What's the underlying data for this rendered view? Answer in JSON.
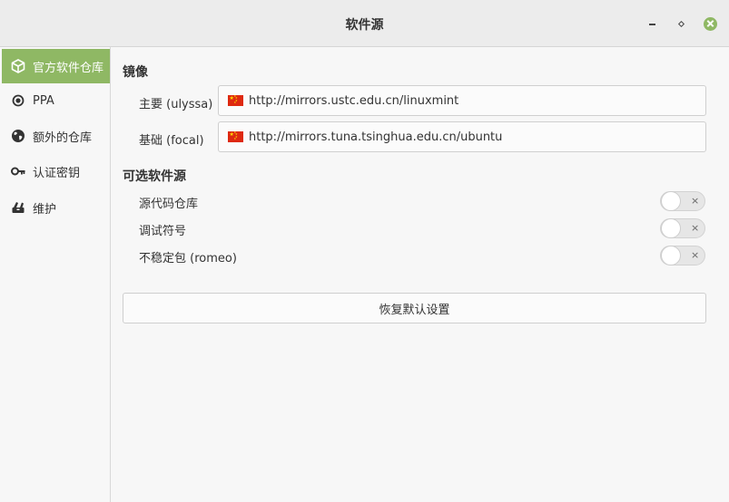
{
  "window": {
    "title": "软件源"
  },
  "sidebar": {
    "items": [
      {
        "label": "官方软件仓库",
        "icon": "package-icon",
        "active": true
      },
      {
        "label": "PPA",
        "icon": "target-icon",
        "active": false
      },
      {
        "label": "额外的仓库",
        "icon": "globe-icon",
        "active": false
      },
      {
        "label": "认证密钥",
        "icon": "key-icon",
        "active": false
      },
      {
        "label": "维护",
        "icon": "tools-icon",
        "active": false
      }
    ]
  },
  "mirrors": {
    "title": "镜像",
    "main_label": "主要 (ulyssa)",
    "main_url": "http://mirrors.ustc.edu.cn/linuxmint",
    "base_label": "基础 (focal)",
    "base_url": "http://mirrors.tuna.tsinghua.edu.cn/ubuntu"
  },
  "optional_sources": {
    "title": "可选软件源",
    "items": [
      {
        "label": "源代码仓库",
        "enabled": false
      },
      {
        "label": "调试符号",
        "enabled": false
      },
      {
        "label": "不稳定包 (romeo)",
        "enabled": false
      }
    ]
  },
  "toggle_off_glyph": "×",
  "restore_button": "恢复默认设置",
  "colors": {
    "accent": "#8fb864",
    "titlebar": "#ececec",
    "background": "#f7f7f7"
  }
}
